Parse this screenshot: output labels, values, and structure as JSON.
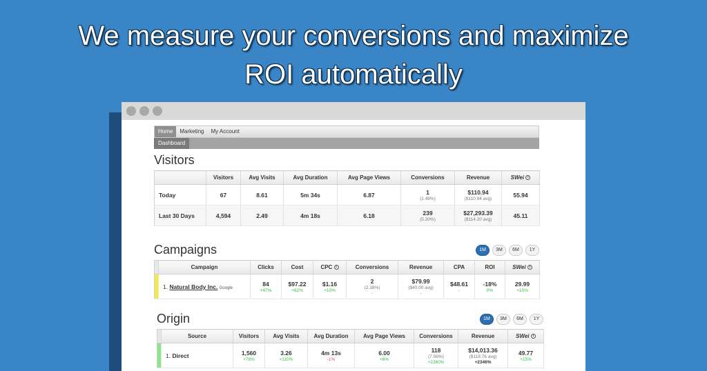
{
  "headline": {
    "line1": "We measure your conversions and maximize",
    "line2": "ROI automatically"
  },
  "nav": {
    "items": [
      "Home",
      "Marketing",
      "My Account"
    ],
    "active": "Home"
  },
  "subnav": {
    "items": [
      "Dashboard"
    ]
  },
  "visitors": {
    "title": "Visitors",
    "headers": [
      "",
      "Visitors",
      "Avg Visits",
      "Avg Duration",
      "Avg Page Views",
      "Conversions",
      "Revenue",
      "SWei"
    ],
    "rows": [
      {
        "label": "Today",
        "visitors": "67",
        "avg_visits": "8.61",
        "avg_duration": "5m 34s",
        "avg_page_views": "6.87",
        "conversions": "1",
        "conversions_sub": "(1.49%)",
        "revenue": "$110.94",
        "revenue_sub": "($110.94 avg)",
        "swei": "55.94"
      },
      {
        "label": "Last 30 Days",
        "visitors": "4,594",
        "avg_visits": "2.49",
        "avg_duration": "4m 18s",
        "avg_page_views": "6.18",
        "conversions": "239",
        "conversions_sub": "(5.20%)",
        "revenue": "$27,293.39",
        "revenue_sub": "($114.20 avg)",
        "swei": "45.11"
      }
    ]
  },
  "campaigns": {
    "title": "Campaigns",
    "ranges": [
      "1M",
      "3M",
      "6M",
      "1Y"
    ],
    "active_range": "1M",
    "headers": [
      "Campaign",
      "Clicks",
      "Cost",
      "CPC",
      "Conversions",
      "Revenue",
      "CPA",
      "ROI",
      "SWei"
    ],
    "rows": [
      {
        "index": "1.",
        "name": "Natural Body Inc.",
        "source": "Google",
        "clicks": "84",
        "clicks_delta": "+47%",
        "cost": "$97.22",
        "cost_delta": "+62%",
        "cpc": "$1.16",
        "cpc_delta": "+10%",
        "conversions": "2",
        "conversions_sub": "(2.38%)",
        "conversions_delta": "-",
        "revenue": "$79.99",
        "revenue_sub": "($40.00 avg)",
        "revenue_delta": "-",
        "cpa": "$48.61",
        "cpa_delta": "-",
        "roi": "-18%",
        "roi_delta": "0%",
        "swei": "29.99",
        "swei_delta": "+15%"
      }
    ]
  },
  "origin": {
    "title": "Origin",
    "ranges": [
      "1M",
      "3M",
      "6M",
      "1Y"
    ],
    "active_range": "1M",
    "headers": [
      "Source",
      "Visitors",
      "Avg Visits",
      "Avg Duration",
      "Avg Page Views",
      "Conversions",
      "Revenue",
      "SWei"
    ],
    "rows": [
      {
        "index": "1.",
        "name": "Direct",
        "visitors": "1,560",
        "visitors_delta": "+78%",
        "avg_visits": "3.26",
        "avg_visits_delta": "+110%",
        "avg_duration": "4m 13s",
        "avg_duration_delta": "-1%",
        "avg_page_views": "6.00",
        "avg_page_views_delta": "+6%",
        "conversions": "118",
        "conversions_sub": "(7.56%)",
        "conversions_delta": "+2260%",
        "revenue": "$14,013.36",
        "revenue_sub": "($118.76 avg)",
        "revenue_delta": "+2346%",
        "swei": "49.77",
        "swei_delta": "+15%"
      }
    ]
  },
  "colors": {
    "background": "#3a85c5",
    "active_button": "#2a6fb0",
    "positive": "#2fbf3f",
    "negative": "#e34b4b",
    "campaign_stripe": "#f5ec4a",
    "origin_stripe": "#8ee58e"
  }
}
